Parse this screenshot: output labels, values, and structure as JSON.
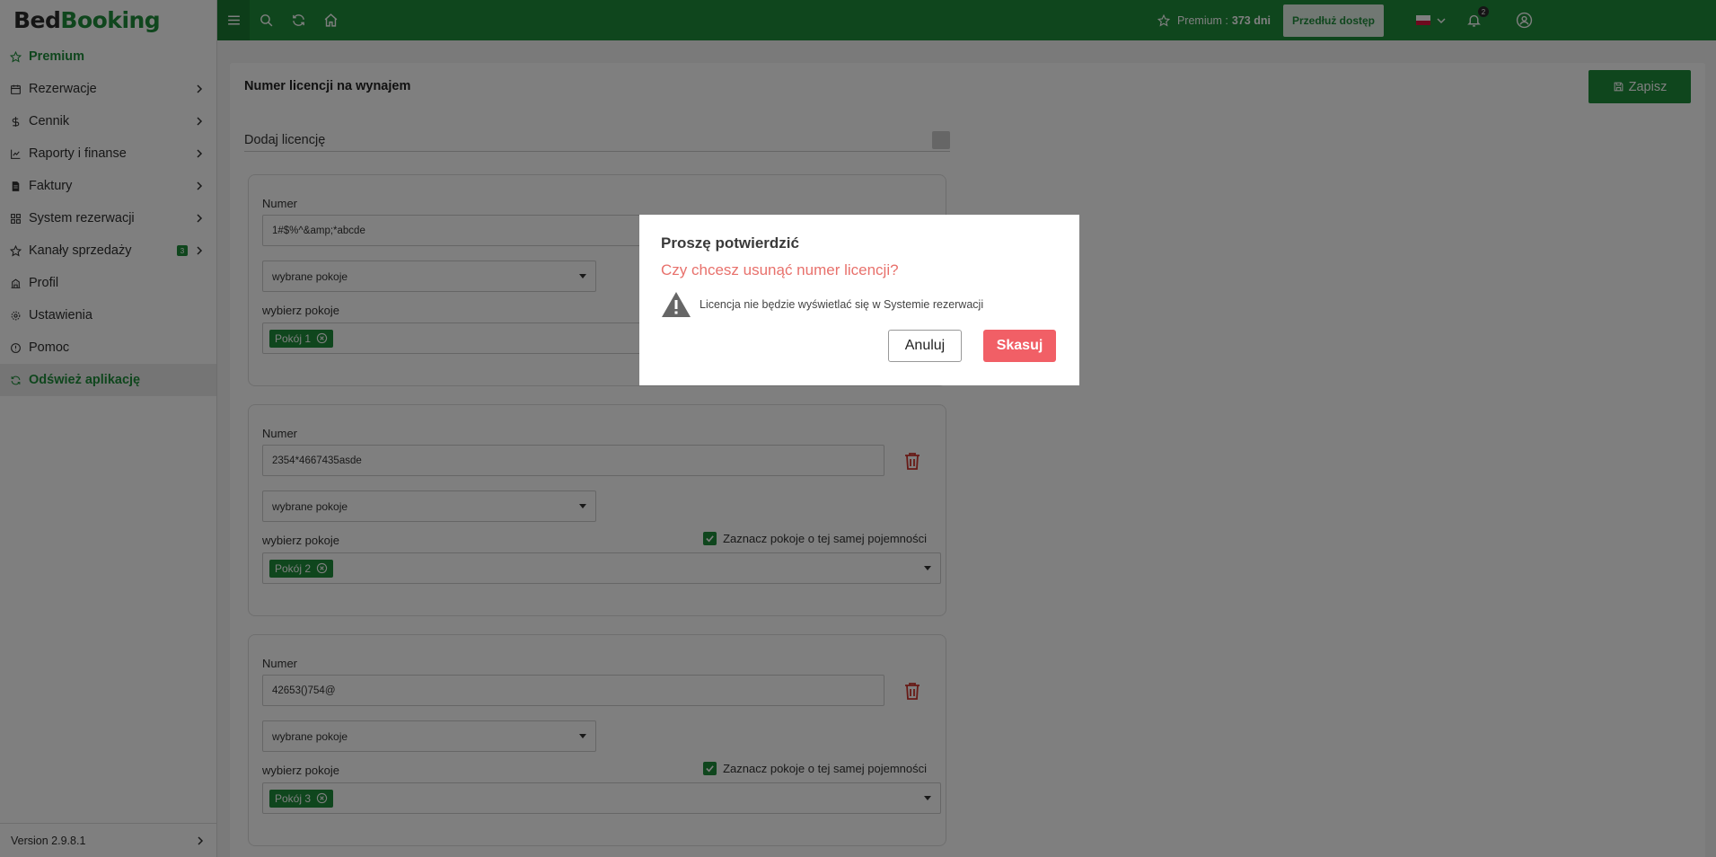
{
  "app": {
    "logo_bed": "Bed",
    "logo_booking": "Booking"
  },
  "sidebar": {
    "items": [
      {
        "label": "Premium",
        "icon": "star-icon"
      },
      {
        "label": "Rezerwacje",
        "icon": "calendar-icon"
      },
      {
        "label": "Cennik",
        "icon": "dollar-icon"
      },
      {
        "label": "Raporty i finanse",
        "icon": "chart-icon"
      },
      {
        "label": "Faktury",
        "icon": "invoice-icon"
      },
      {
        "label": "System rezerwacji",
        "icon": "grid-icon"
      },
      {
        "label": "Kanały sprzedaży",
        "icon": "star-icon",
        "badge": "3"
      },
      {
        "label": "Profil",
        "icon": "building-icon"
      },
      {
        "label": "Ustawienia",
        "icon": "gear-icon"
      },
      {
        "label": "Pomoc",
        "icon": "info-icon"
      },
      {
        "label": "Odśwież aplikację",
        "icon": "refresh-icon"
      }
    ],
    "version": "Version 2.9.8.1"
  },
  "topbar": {
    "premium_label": "Premium :",
    "premium_days": "373 dni",
    "extend_button": "Przedłuż dostęp",
    "notifications_count": "2"
  },
  "page": {
    "title": "Numer licencji na wynajem",
    "save_button": "Zapisz",
    "add_license": "Dodaj licencję"
  },
  "licenses": [
    {
      "label": "Numer",
      "value": "1#$%^&amp;*abcde",
      "select": "wybrane pokoje",
      "choose_label": "wybierz pokoje",
      "room": "Pokój 1"
    },
    {
      "label": "Numer",
      "value": "2354*4667435asde",
      "select": "wybrane pokoje",
      "choose_label": "wybierz pokoje",
      "same_capacity": "Zaznacz pokoje o tej samej pojemności",
      "room": "Pokój 2"
    },
    {
      "label": "Numer",
      "value": "42653()754@",
      "select": "wybrane pokoje",
      "choose_label": "wybierz pokoje",
      "same_capacity": "Zaznacz pokoje o tej samej pojemności",
      "room": "Pokój 3"
    }
  ],
  "modal": {
    "title": "Proszę potwierdzić",
    "question": "Czy chcesz usunąć numer licencji?",
    "warning": "Licencja nie będzie wyświetlać się w Systemie rezerwacji",
    "cancel": "Anuluj",
    "delete": "Skasuj"
  },
  "colors": {
    "brand": "#1e8c3a",
    "danger": "#f15f66",
    "question": "#e8716c"
  }
}
